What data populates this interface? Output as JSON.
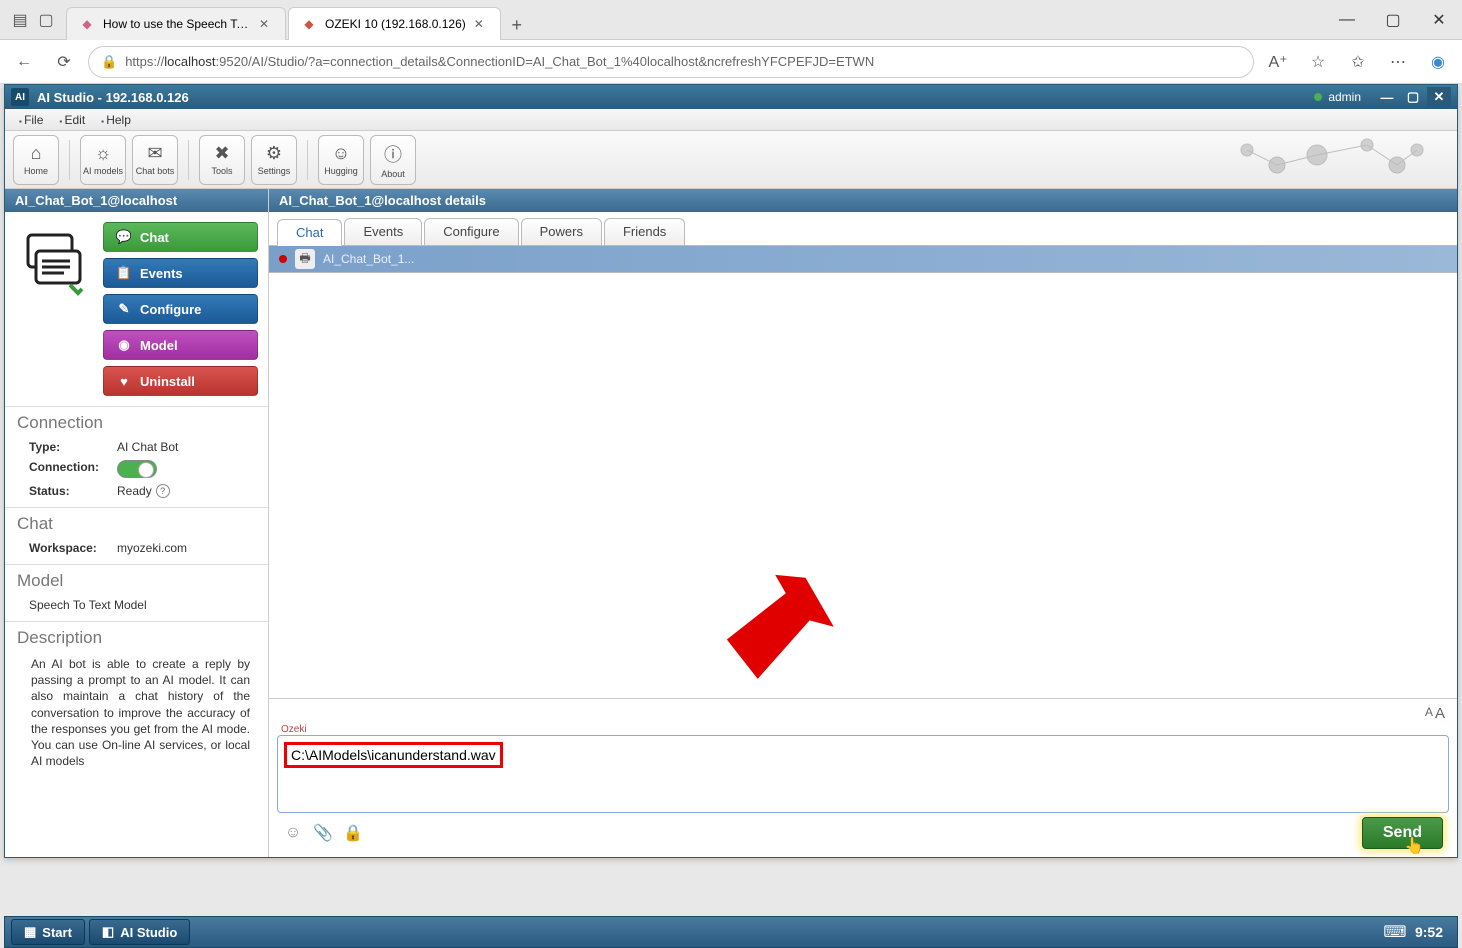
{
  "browser": {
    "tabs": [
      {
        "title": "How to use the Speech To Text m",
        "favicon_color": "#cc6688"
      },
      {
        "title": "OZEKI 10 (192.168.0.126)",
        "favicon_color": "#cc5544"
      }
    ],
    "url_prefix": "https://",
    "url_host": "localhost",
    "url_rest": ":9520/AI/Studio/?a=connection_details&ConnectionID=AI_Chat_Bot_1%40localhost&ncrefreshYFCPEFJD=ETWN"
  },
  "app": {
    "title": "AI Studio - 192.168.0.126",
    "user": "admin",
    "menus": [
      "File",
      "Edit",
      "Help"
    ],
    "toolbar": [
      {
        "label": "Home"
      },
      {
        "label": "AI models"
      },
      {
        "label": "Chat bots"
      },
      {
        "label": "Tools"
      },
      {
        "label": "Settings"
      },
      {
        "label": "Hugging"
      },
      {
        "label": "About"
      }
    ]
  },
  "sidebar": {
    "header": "AI_Chat_Bot_1@localhost",
    "actions": {
      "chat": "Chat",
      "events": "Events",
      "configure": "Configure",
      "model": "Model",
      "uninstall": "Uninstall"
    },
    "sections": {
      "connection": {
        "title": "Connection",
        "type_label": "Type:",
        "type_value": "AI Chat Bot",
        "conn_label": "Connection:",
        "status_label": "Status:",
        "status_value": "Ready"
      },
      "chat": {
        "title": "Chat",
        "ws_label": "Workspace:",
        "ws_value": "myozeki.com"
      },
      "model": {
        "title": "Model",
        "model_value": "Speech To Text Model"
      },
      "description": {
        "title": "Description",
        "text": "An AI bot is able to create a reply by passing a prompt to an AI model. It can also maintain a chat history of the conversation to improve the accuracy of the responses you get from the AI mode. You can use On-line AI services, or local AI models"
      }
    }
  },
  "main": {
    "header": "AI_Chat_Bot_1@localhost details",
    "tabs": [
      "Chat",
      "Events",
      "Configure",
      "Powers",
      "Friends"
    ],
    "chat_participant": "AI_Chat_Bot_1...",
    "input_label_small": "Ozeki",
    "input_value": "C:\\AIModels\\icanunderstand.wav",
    "send_label": "Send"
  },
  "taskbar": {
    "start": "Start",
    "app": "AI Studio",
    "clock": "9:52"
  }
}
